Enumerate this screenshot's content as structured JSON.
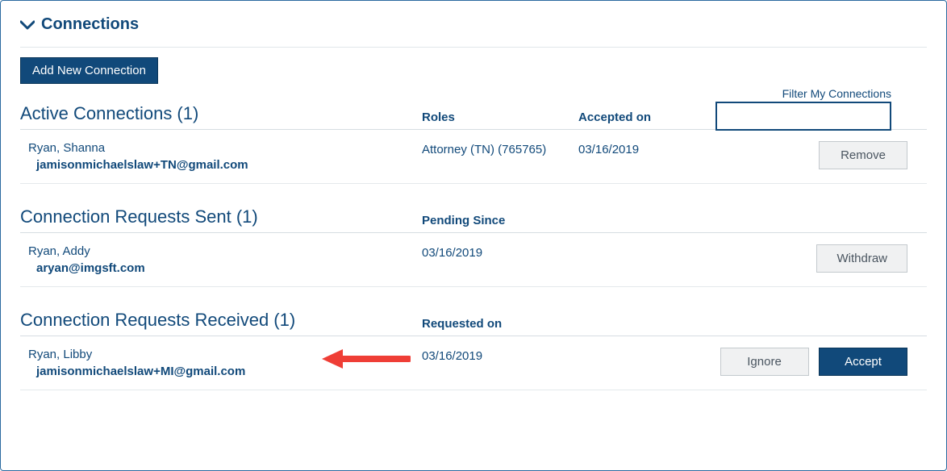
{
  "header": {
    "title": "Connections"
  },
  "buttons": {
    "add_new": "Add New Connection",
    "remove": "Remove",
    "withdraw": "Withdraw",
    "ignore": "Ignore",
    "accept": "Accept"
  },
  "filter": {
    "label": "Filter My Connections",
    "value": ""
  },
  "sections": {
    "active": {
      "title": "Active Connections (1)",
      "col_roles": "Roles",
      "col_date": "Accepted on",
      "rows": [
        {
          "name": "Ryan, Shanna",
          "email": "jamisonmichaelslaw+TN@gmail.com",
          "roles": "Attorney (TN) (765765)",
          "date": "03/16/2019"
        }
      ]
    },
    "sent": {
      "title": "Connection Requests Sent (1)",
      "col_date": "Pending Since",
      "rows": [
        {
          "name": "Ryan, Addy",
          "email": "aryan@imgsft.com",
          "date": "03/16/2019"
        }
      ]
    },
    "received": {
      "title": "Connection Requests Received (1)",
      "col_date": "Requested on",
      "rows": [
        {
          "name": "Ryan, Libby",
          "email": "jamisonmichaelslaw+MI@gmail.com",
          "date": "03/16/2019"
        }
      ]
    }
  }
}
